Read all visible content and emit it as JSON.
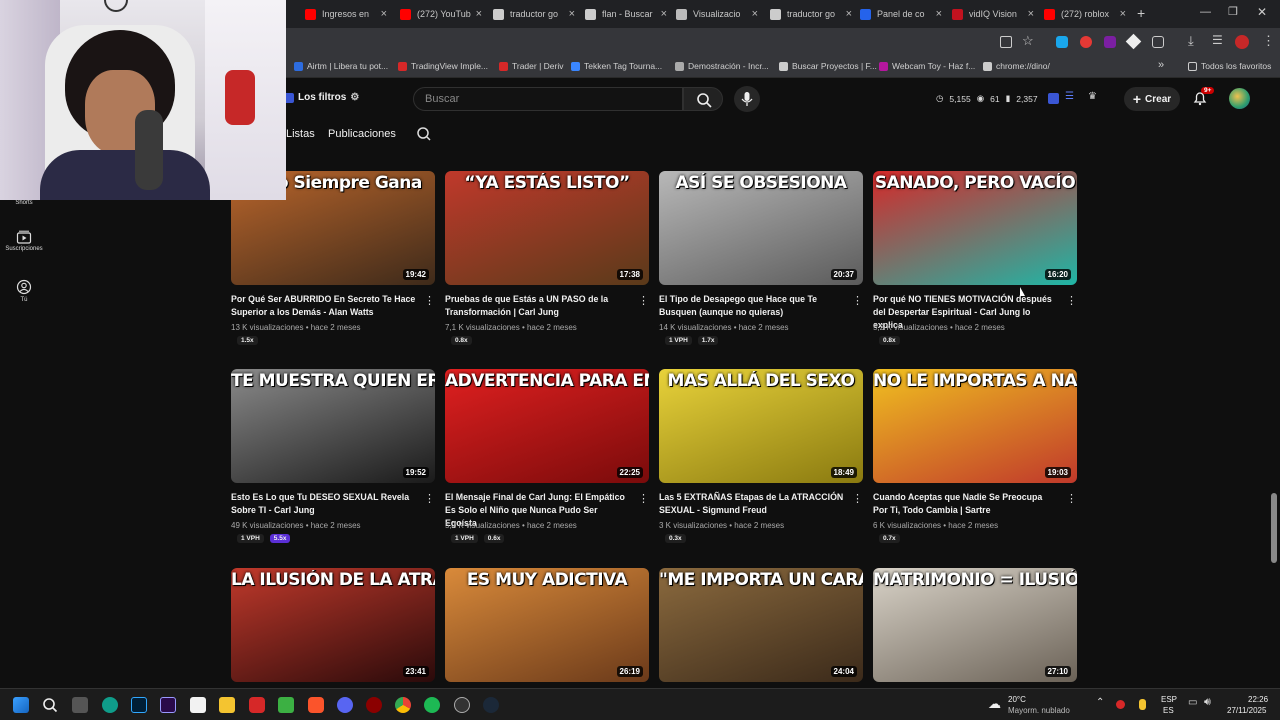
{
  "browser": {
    "tabs": [
      {
        "label": "Ingresos en",
        "icon_color": "#ff0000"
      },
      {
        "label": "(272) YouTub",
        "icon_color": "#ff0000"
      },
      {
        "label": "traductor go",
        "icon_color": "#cccccc"
      },
      {
        "label": "flan - Buscar",
        "icon_color": "#cccccc"
      },
      {
        "label": "Visualizacio",
        "icon_color": "#bbbbbb"
      },
      {
        "label": "traductor go",
        "icon_color": "#cccccc"
      },
      {
        "label": "Panel de co",
        "icon_color": "#2563eb"
      },
      {
        "label": "vidIQ Vision",
        "icon_color": "#c1121f"
      },
      {
        "label": "(272) roblox",
        "icon_color": "#ff0000"
      }
    ],
    "new_tab": "+",
    "bookmarks": [
      {
        "label": "Airtm | Libera tu pot...",
        "icon_color": "#2d6cdf"
      },
      {
        "label": "TradingView Imple...",
        "icon_color": "#d62828"
      },
      {
        "label": "Trader | Deriv",
        "icon_color": "#d62828"
      },
      {
        "label": "Tekken Tag Tourna...",
        "icon_color": "#3a86ff"
      },
      {
        "label": "Demostración - Incr...",
        "icon_color": "#aaaaaa"
      },
      {
        "label": "Buscar Proyectos | F...",
        "icon_color": "#cccccc"
      },
      {
        "label": "Webcam Toy - Haz f...",
        "icon_color": "#b5179e"
      },
      {
        "label": "chrome://dino/",
        "icon_color": "#cccccc"
      }
    ],
    "all_favorites": "Todos los favoritos"
  },
  "header": {
    "filters_label": "Los filtros",
    "search_placeholder": "Buscar",
    "stats": [
      "5,155",
      "61",
      "2,357"
    ],
    "create_label": "Crear",
    "notifications_badge": "9+"
  },
  "channel_tabs": [
    "Listas",
    "Publicaciones"
  ],
  "sidebar": [
    {
      "label": "Shorts"
    },
    {
      "label": "Suscripciones"
    },
    {
      "label": "Tú"
    }
  ],
  "videos": [
    {
      "thumb_text": "rrido Siempre Gana",
      "duration": "19:42",
      "title": "Por Qué Ser ABURRIDO En Secreto Te Hace Superior a los Demás - Alan Watts",
      "views": "13 K visualizaciones",
      "age": "hace 2 meses",
      "badges": [
        "1.5x"
      ],
      "colors": [
        "#b9652b",
        "#3e2a1a"
      ]
    },
    {
      "thumb_text": "“YA ESTÁS LISTO”",
      "duration": "17:38",
      "title": "Pruebas de que Estás a UN PASO de la Transformación | Carl Jung",
      "views": "7,1 K visualizaciones",
      "age": "hace 2 meses",
      "badges": [
        "0.8x"
      ],
      "colors": [
        "#c0392b",
        "#5a3a1a"
      ]
    },
    {
      "thumb_text": "ASÍ SE OBSESIONA",
      "duration": "20:37",
      "title": "El Tipo de Desapego que Hace que Te Busquen (aunque no quieras)",
      "views": "14 K visualizaciones",
      "age": "hace 2 meses",
      "badges": [
        "1 VPH",
        "1.7x"
      ],
      "colors": [
        "#b8b8b8",
        "#5b5b5b"
      ]
    },
    {
      "thumb_text": "SANADO, PERO VACÍO",
      "duration": "16:20",
      "title": "Por qué NO TIENES MOTIVACIÓN después del Despertar Espiritual - Carl Jung lo explica",
      "views": "5,2 K visualizaciones",
      "age": "hace 2 meses",
      "badges": [
        "0.8x"
      ],
      "colors": [
        "#d62828",
        "#1fb6a6"
      ]
    },
    {
      "thumb_text": "TE MUESTRA QUIEN ERES",
      "duration": "19:52",
      "title": "Esto Es Lo que Tu DESEO SEXUAL Revela Sobre TI - Carl Jung",
      "views": "49 K visualizaciones",
      "age": "hace 2 meses",
      "badges": [
        "1 VPH",
        "5.5x"
      ],
      "colors": [
        "#8a8a8a",
        "#1a1a1a"
      ]
    },
    {
      "thumb_text": "ADVERTENCIA PARA EMPÁTICOS",
      "duration": "22:25",
      "title": "El Mensaje Final de Carl Jung: El Empático Es Solo el Niño que Nunca Pudo Ser Egoísta",
      "views": "5,2 K visualizaciones",
      "age": "hace 2 meses",
      "badges": [
        "1 VPH",
        "0.6x"
      ],
      "colors": [
        "#e02020",
        "#7a0b0b"
      ]
    },
    {
      "thumb_text": "MAS ALLÁ DEL SEXO",
      "duration": "18:49",
      "title": "Las 5 EXTRAÑAS Etapas de La ATRACCIÓN SEXUAL - Sigmund Freud",
      "views": "3 K visualizaciones",
      "age": "hace 2 meses",
      "badges": [
        "0.3x"
      ],
      "colors": [
        "#e8d23a",
        "#8a7a10"
      ]
    },
    {
      "thumb_text": "NO LE IMPORTAS A NADIE",
      "duration": "19:03",
      "title": "Cuando Aceptas que Nadie Se Preocupa Por Ti, Todo Cambia | Sartre",
      "views": "6 K visualizaciones",
      "age": "hace 2 meses",
      "badges": [
        "0.7x"
      ],
      "colors": [
        "#f0c020",
        "#c0392b"
      ]
    },
    {
      "thumb_text": "LA ILUSIÓN DE LA ATRACCIÓN",
      "duration": "23:41",
      "title": "",
      "views": "",
      "age": "",
      "badges": [],
      "colors": [
        "#c0392b",
        "#2a0a0a"
      ]
    },
    {
      "thumb_text": "ES MUY ADICTIVA",
      "duration": "26:19",
      "title": "",
      "views": "",
      "age": "",
      "badges": [],
      "colors": [
        "#d98a3a",
        "#6b3a1a"
      ]
    },
    {
      "thumb_text": "\"ME IMPORTA UN CARAJO\"",
      "duration": "24:04",
      "title": "",
      "views": "",
      "age": "",
      "badges": [],
      "colors": [
        "#8b6a3e",
        "#3b2a1a"
      ]
    },
    {
      "thumb_text": "MATRIMONIO = ILUSIÓN",
      "duration": "27:10",
      "title": "",
      "views": "",
      "age": "",
      "badges": [],
      "colors": [
        "#d9d3c8",
        "#6b6257"
      ]
    }
  ],
  "taskbar": {
    "weather_temp": "20°C",
    "weather_desc": "Mayorm. nublado",
    "lang_top": "ESP",
    "lang_bottom": "ES",
    "time": "22:26",
    "date": "27/11/2025"
  }
}
